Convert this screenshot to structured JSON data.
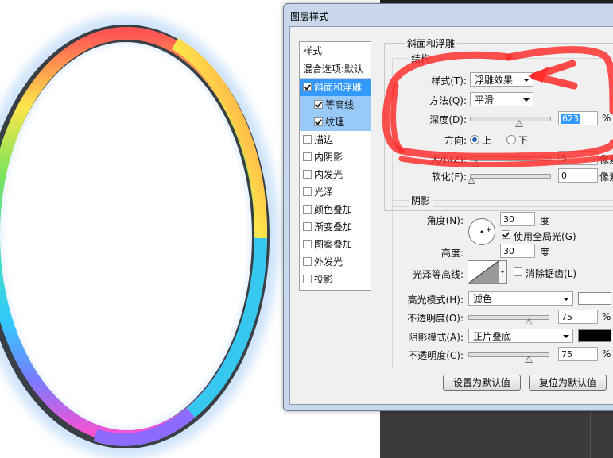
{
  "dialog": {
    "title": "图层样式"
  },
  "style_list": {
    "header": "样式",
    "blend_options": "混合选项:默认",
    "items": [
      {
        "label": "斜面和浮雕",
        "checked": true,
        "level": 0,
        "selected": true
      },
      {
        "label": "等高线",
        "checked": true,
        "level": 1,
        "selected": false
      },
      {
        "label": "纹理",
        "checked": true,
        "level": 1,
        "selected": false
      },
      {
        "label": "描边",
        "checked": false,
        "level": 0,
        "selected": false
      },
      {
        "label": "内阴影",
        "checked": false,
        "level": 0,
        "selected": false
      },
      {
        "label": "内发光",
        "checked": false,
        "level": 0,
        "selected": false
      },
      {
        "label": "光泽",
        "checked": false,
        "level": 0,
        "selected": false
      },
      {
        "label": "颜色叠加",
        "checked": false,
        "level": 0,
        "selected": false
      },
      {
        "label": "渐变叠加",
        "checked": false,
        "level": 0,
        "selected": false
      },
      {
        "label": "图案叠加",
        "checked": false,
        "level": 0,
        "selected": false
      },
      {
        "label": "外发光",
        "checked": false,
        "level": 0,
        "selected": false
      },
      {
        "label": "投影",
        "checked": false,
        "level": 0,
        "selected": false
      }
    ]
  },
  "bevel": {
    "group_title": "斜面和浮雕",
    "structure_title": "结构",
    "style_label": "样式(T):",
    "style_value": "浮雕效果",
    "technique_label": "方法(Q):",
    "technique_value": "平滑",
    "depth_label": "深度(D):",
    "depth_value": "623",
    "depth_unit": "%",
    "direction_label": "方向:",
    "direction_up": "上",
    "direction_down": "下",
    "size_label": "大小(Z):",
    "size_value": "5",
    "size_unit": "像素",
    "soften_label": "软化(F):",
    "soften_value": "0",
    "soften_unit": "像素"
  },
  "shading": {
    "group_title": "阴影",
    "angle_label": "角度(N):",
    "angle_value": "30",
    "angle_unit": "度",
    "global_light_label": "使用全局光(G)",
    "global_light_checked": true,
    "altitude_label": "高度:",
    "altitude_value": "30",
    "altitude_unit": "度",
    "gloss_label": "光泽等高线:",
    "antialias_label": "消除锯齿(L)",
    "antialias_checked": false,
    "highlight_mode_label": "高光模式(H):",
    "highlight_mode_value": "滤色",
    "highlight_color": "#ffffff",
    "highlight_opacity_label": "不透明度(O):",
    "highlight_opacity_value": "75",
    "opacity_unit": "%",
    "shadow_mode_label": "阴影模式(A):",
    "shadow_mode_value": "正片叠底",
    "shadow_color": "#000000",
    "shadow_opacity_label": "不透明度(C):",
    "shadow_opacity_value": "75"
  },
  "buttons": {
    "make_default": "设置为默认值",
    "reset_default": "复位为默认值"
  },
  "colors": {
    "selection": "#3399ff",
    "annotation": "#ff2a2a"
  }
}
